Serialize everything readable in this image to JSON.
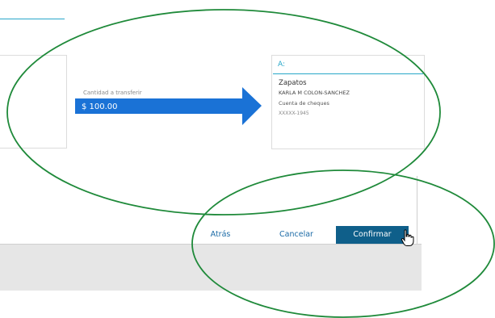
{
  "transfer": {
    "amount_label": "Cantidad a transferir",
    "amount": "$ 100.00"
  },
  "to_account": {
    "heading": "A:",
    "name": "Zapatos",
    "holder": "KARLA M COLON-SANCHEZ",
    "type": "Cuenta de cheques",
    "number": "XXXXX-1945"
  },
  "actions": {
    "back_label": "Atrás",
    "cancel_label": "Cancelar",
    "confirm_label": "Confirmar"
  },
  "colors": {
    "accent": "#28a7c9",
    "arrow": "#1a72d6",
    "confirm_bg": "#0f5f8a",
    "annotation": "#1f8a3a"
  },
  "icons": {
    "transfer_arrow": "right-arrow-icon",
    "cursor": "hand-pointer-icon"
  }
}
